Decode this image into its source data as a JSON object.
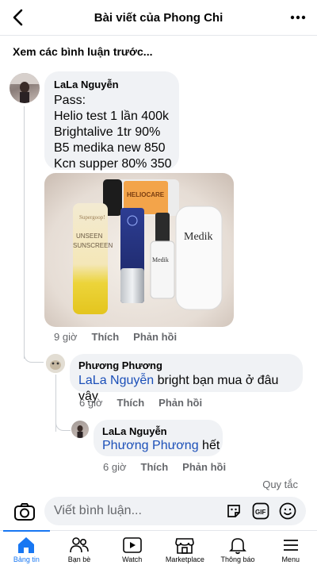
{
  "header": {
    "title": "Bài viết của Phong Chi"
  },
  "previous_comments_label": "Xem các bình luận trước...",
  "comments": [
    {
      "author": "LaLa Nguyễn",
      "text": "Pass:\nHelio test 1 lần 400k\nBrightalive 1tr 90%\nB5 medika new 850\nKcn supper 80% 350",
      "time": "9 giờ",
      "like": "Thích",
      "reply": "Phản hồi",
      "photo": {
        "products": [
          {
            "label_line1": "UNSEEN",
            "label_line2": "SUNSCREEN",
            "brand": "Supergoop!"
          },
          {
            "label": "HELIOCARE",
            "sub": "360°"
          },
          {
            "label": "Medik8"
          },
          {
            "label": "Medik8"
          }
        ]
      }
    },
    {
      "author": "Phương Phương",
      "mention": "LaLa Nguyễn",
      "text": " bright bạn mua ở đâu vậy",
      "time": "6 giờ",
      "like": "Thích",
      "reply": "Phản hồi"
    },
    {
      "author": "LaLa Nguyễn",
      "mention": "Phương Phương",
      "text": " hết",
      "time": "6 giờ",
      "like": "Thích",
      "reply": "Phản hồi"
    }
  ],
  "rules_link": "Quy tắc",
  "composer": {
    "placeholder": "Viết bình luận..."
  },
  "tabs": [
    {
      "label": "Bảng tin",
      "icon": "home-icon",
      "active": true
    },
    {
      "label": "Bạn bè",
      "icon": "friends-icon"
    },
    {
      "label": "Watch",
      "icon": "watch-icon"
    },
    {
      "label": "Marketplace",
      "icon": "marketplace-icon"
    },
    {
      "label": "Thông báo",
      "icon": "bell-icon"
    },
    {
      "label": "Menu",
      "icon": "menu-icon"
    }
  ],
  "colors": {
    "accent": "#1877f2",
    "mention": "#1b4fb8",
    "bubble": "#f0f2f5",
    "muted": "#65676b"
  }
}
